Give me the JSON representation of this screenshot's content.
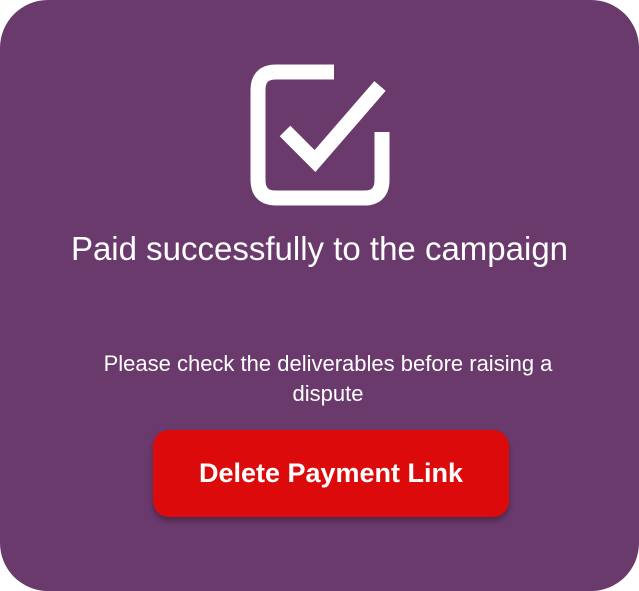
{
  "dialog": {
    "icon": "checkbox-checked-icon",
    "title": "Paid successfully to the campaign",
    "message": "Please check the deliverables before raising a dispute",
    "button_label": "Delete Payment Link"
  },
  "colors": {
    "background": "#6a3a6c",
    "button": "#dd0a0b",
    "text": "#ffffff"
  }
}
